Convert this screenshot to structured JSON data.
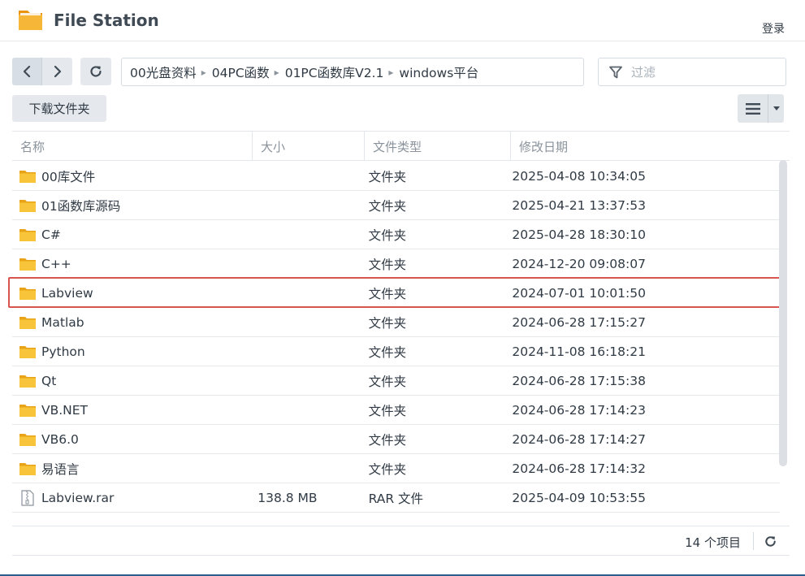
{
  "app": {
    "title": "File Station",
    "login_label": "登录"
  },
  "toolbar": {
    "download_label": "下载文件夹"
  },
  "breadcrumb": [
    {
      "label": "00光盘资料"
    },
    {
      "label": "04PC函数"
    },
    {
      "label": "01PC函数库V2.1"
    },
    {
      "label": "windows平台"
    }
  ],
  "filter": {
    "placeholder": "过滤",
    "value": ""
  },
  "table": {
    "columns": [
      "名称",
      "大小",
      "文件类型",
      "修改日期"
    ],
    "rows": [
      {
        "name": "00库文件",
        "size": "",
        "type": "文件夹",
        "modified": "2025-04-08 10:34:05",
        "icon": "folder-icon"
      },
      {
        "name": "01函数库源码",
        "size": "",
        "type": "文件夹",
        "modified": "2025-04-21 13:37:53",
        "icon": "folder-icon"
      },
      {
        "name": "C#",
        "size": "",
        "type": "文件夹",
        "modified": "2025-04-28 18:30:10",
        "icon": "folder-icon"
      },
      {
        "name": "C++",
        "size": "",
        "type": "文件夹",
        "modified": "2024-12-20 09:08:07",
        "icon": "folder-icon"
      },
      {
        "name": "Labview",
        "size": "",
        "type": "文件夹",
        "modified": "2024-07-01 10:01:50",
        "icon": "folder-icon",
        "highlighted": true
      },
      {
        "name": "Matlab",
        "size": "",
        "type": "文件夹",
        "modified": "2024-06-28 17:15:27",
        "icon": "folder-icon"
      },
      {
        "name": "Python",
        "size": "",
        "type": "文件夹",
        "modified": "2024-11-08 16:18:21",
        "icon": "folder-icon"
      },
      {
        "name": "Qt",
        "size": "",
        "type": "文件夹",
        "modified": "2024-06-28 17:15:38",
        "icon": "folder-icon"
      },
      {
        "name": "VB.NET",
        "size": "",
        "type": "文件夹",
        "modified": "2024-06-28 17:14:23",
        "icon": "folder-icon"
      },
      {
        "name": "VB6.0",
        "size": "",
        "type": "文件夹",
        "modified": "2024-06-28 17:14:27",
        "icon": "folder-icon"
      },
      {
        "name": "易语言",
        "size": "",
        "type": "文件夹",
        "modified": "2024-06-28 17:14:32",
        "icon": "folder-icon"
      },
      {
        "name": "Labview.rar",
        "size": "138.8 MB",
        "type": "RAR 文件",
        "modified": "2025-04-09 10:53:55",
        "icon": "archive-file-icon"
      }
    ]
  },
  "footer": {
    "item_count": "14 个项目"
  },
  "colors": {
    "highlight_border": "#d9534f",
    "folder": "#f5b922",
    "accent_bottom": "#2d5f8e"
  }
}
